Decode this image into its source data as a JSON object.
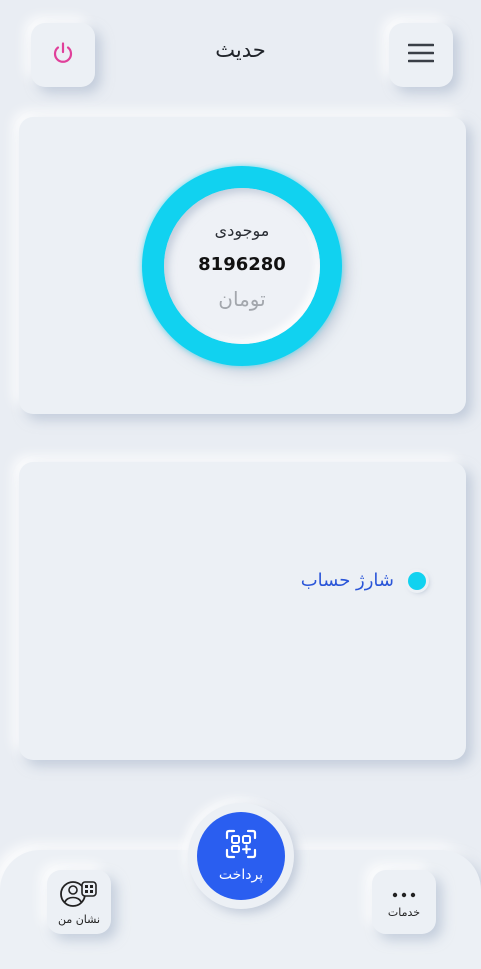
{
  "header": {
    "title": "حدیث",
    "power_icon": "power-icon",
    "menu_icon": "menu-icon"
  },
  "balance": {
    "label": "موجودی",
    "amount": "8196280",
    "unit": "تومان",
    "ring_color": "#11d2f0"
  },
  "actions": {
    "items": [
      {
        "label": "شارژ حساب",
        "icon": "bullet-dot-icon"
      }
    ]
  },
  "bottom_nav": {
    "mine_label": "نشان من",
    "services_label": "خدمات",
    "pay_label": "پرداخت",
    "pay_color": "#2a5ef0"
  },
  "colors": {
    "accent": "#11d2f0",
    "primary": "#2a5ef0",
    "power": "#e0409a",
    "background": "#e9edf3"
  }
}
